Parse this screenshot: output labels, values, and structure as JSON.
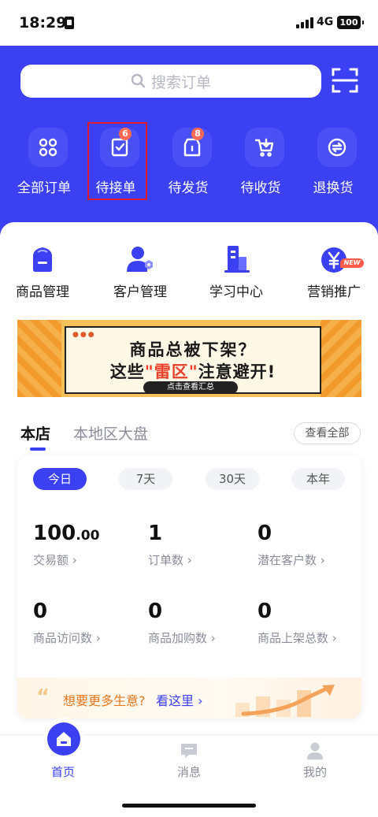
{
  "status_bar": {
    "time": "18:29",
    "network": "4G",
    "battery": "100"
  },
  "search": {
    "placeholder": "搜索订单"
  },
  "orders": [
    {
      "label": "全部订单",
      "icon": "grid-icon",
      "badge": ""
    },
    {
      "label": "待接单",
      "icon": "clipboard-check-icon",
      "badge": "6"
    },
    {
      "label": "待发货",
      "icon": "package-icon",
      "badge": "8"
    },
    {
      "label": "待收货",
      "icon": "cart-icon",
      "badge": ""
    },
    {
      "label": "退换货",
      "icon": "exchange-icon",
      "badge": ""
    }
  ],
  "tools": [
    {
      "label": "商品管理",
      "icon": "shopping-bag-icon"
    },
    {
      "label": "客户管理",
      "icon": "customer-icon"
    },
    {
      "label": "学习中心",
      "icon": "building-icon"
    },
    {
      "label": "营销推广",
      "icon": "yuan-coin-icon",
      "badge": "NEW"
    }
  ],
  "banner": {
    "line1": "商品总被下架？",
    "line2_a": "这些",
    "line2_red": "\"雷区\"",
    "line2_b": "注意避开!",
    "button": "点击查看汇总"
  },
  "tabs": {
    "active": "本店",
    "other": "本地区大盘",
    "view_all": "查看全部"
  },
  "periods": [
    "今日",
    "7天",
    "30天",
    "本年"
  ],
  "metrics": [
    {
      "value": "100",
      "decimal": ".00",
      "label": "交易额 ›"
    },
    {
      "value": "1",
      "decimal": "",
      "label": "订单数 ›"
    },
    {
      "value": "0",
      "decimal": "",
      "label": "潜在客户数 ›"
    },
    {
      "value": "0",
      "decimal": "",
      "label": "商品访问数 ›"
    },
    {
      "value": "0",
      "decimal": "",
      "label": "商品加购数 ›"
    },
    {
      "value": "0",
      "decimal": "",
      "label": "商品上架总数 ›"
    }
  ],
  "more": {
    "text": "想要更多生意?",
    "link": "看这里 ›"
  },
  "nav": [
    {
      "label": "首页",
      "icon": "home-icon",
      "active": true
    },
    {
      "label": "消息",
      "icon": "message-icon",
      "active": false
    },
    {
      "label": "我的",
      "icon": "profile-icon",
      "active": false
    }
  ],
  "colors": {
    "primary": "#3b40f2",
    "badge": "#ff6b57",
    "highlight_box": "#e0192f",
    "accent_orange": "#e8761c"
  }
}
